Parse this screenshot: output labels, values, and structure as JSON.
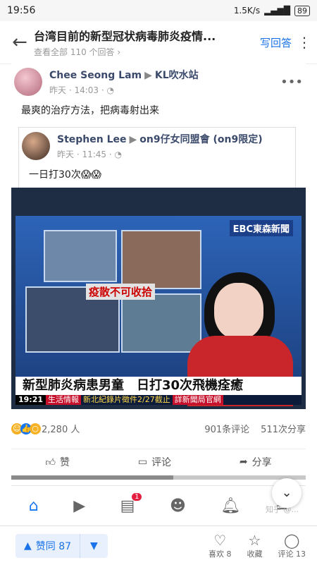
{
  "status": {
    "time": "19:56",
    "speed": "1.5K/s",
    "battery": "89"
  },
  "question": {
    "title": "台湾目前的新型冠状病毒肺炎疫情...",
    "subtitle": "查看全部 110 个回答 ›",
    "write_answer": "写回答"
  },
  "post": {
    "author": "Chee Seong Lam",
    "group": "KL吹水站",
    "time": "昨天 · 14:03 ·",
    "text": "最爽的治疗方法，把病毒射出来",
    "shared": {
      "author": "Stephen Lee",
      "group": "on9仔女同盟會 (on9限定)",
      "time": "昨天 · 11:45 ·",
      "text": "一日打30次😱😱"
    }
  },
  "tv": {
    "logo": "EBC東森新聞",
    "overlay": "疫散不可收拾",
    "headline": "新型肺炎病患男童　日打30次飛機痊癒",
    "time": "19:21",
    "tag": "生活情報",
    "ticker1": "新北紀錄片徵件2/27截止",
    "ticker2": "詳新聞局官網"
  },
  "stats": {
    "reactions": "2,280 人",
    "comments": "901条评论",
    "shares": "511次分享"
  },
  "actions": {
    "like": "赞",
    "comment": "评论",
    "share": "分享"
  },
  "progress_fraction": 0.55,
  "nav_badge": "1",
  "watermark": "知乎 @...",
  "bottom": {
    "vote_up": "赞同 87",
    "like_label": "喜欢 8",
    "favorite_label": "收藏",
    "comment_label": "评论 13"
  },
  "colors": {
    "accent": "#1a73e8",
    "fb_blue": "#1877f2",
    "tv_red": "#c6102b"
  }
}
